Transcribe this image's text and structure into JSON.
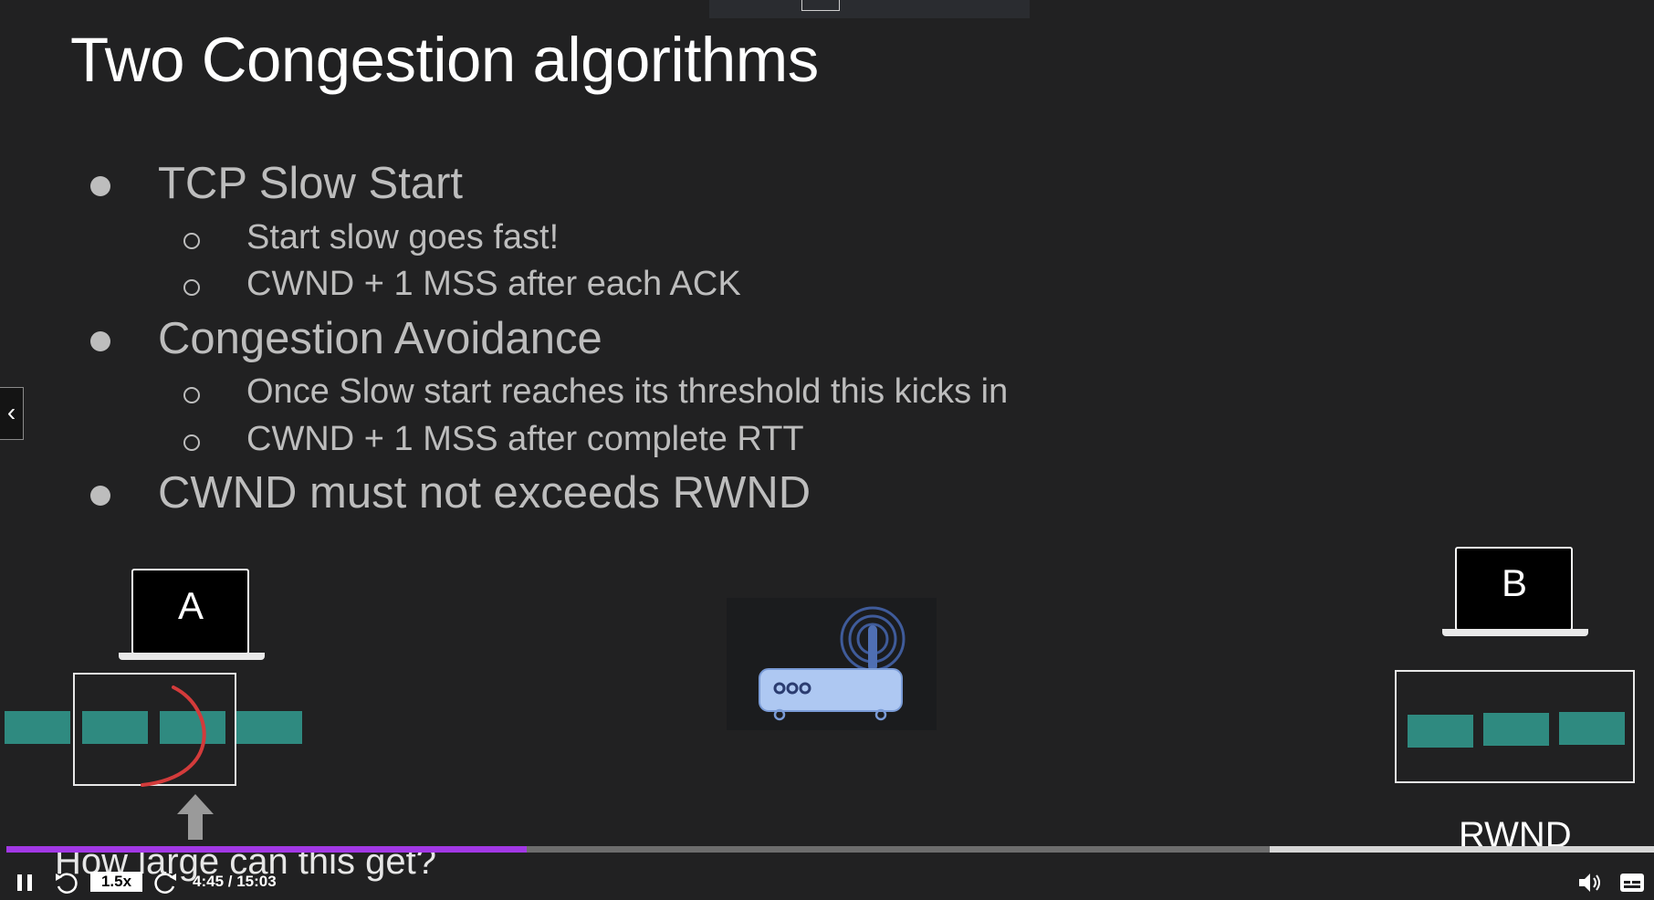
{
  "slide": {
    "title": "Two Congestion algorithms",
    "bullets": [
      {
        "text": "TCP Slow Start",
        "sub": [
          "Start slow goes fast!",
          "CWND + 1 MSS after each ACK"
        ]
      },
      {
        "text": "Congestion Avoidance",
        "sub": [
          "Once Slow start reaches its threshold this kicks in",
          "CWND + 1 MSS after complete RTT"
        ]
      },
      {
        "text": "CWND must not exceeds RWND",
        "sub": []
      }
    ],
    "host_a_label": "A",
    "host_b_label": "B",
    "rwnd_label": "RWND",
    "caption": "How large can this get?"
  },
  "player": {
    "speed": "1.5x",
    "time": "4:45 / 15:03",
    "progress_fraction": 0.316,
    "buffered_start_fraction": 0.767,
    "accent": "#a238e5",
    "icons": [
      "chevron-left-icon",
      "pause-icon",
      "rewind-icon",
      "forward-icon",
      "volume-icon",
      "captions-icon"
    ]
  }
}
